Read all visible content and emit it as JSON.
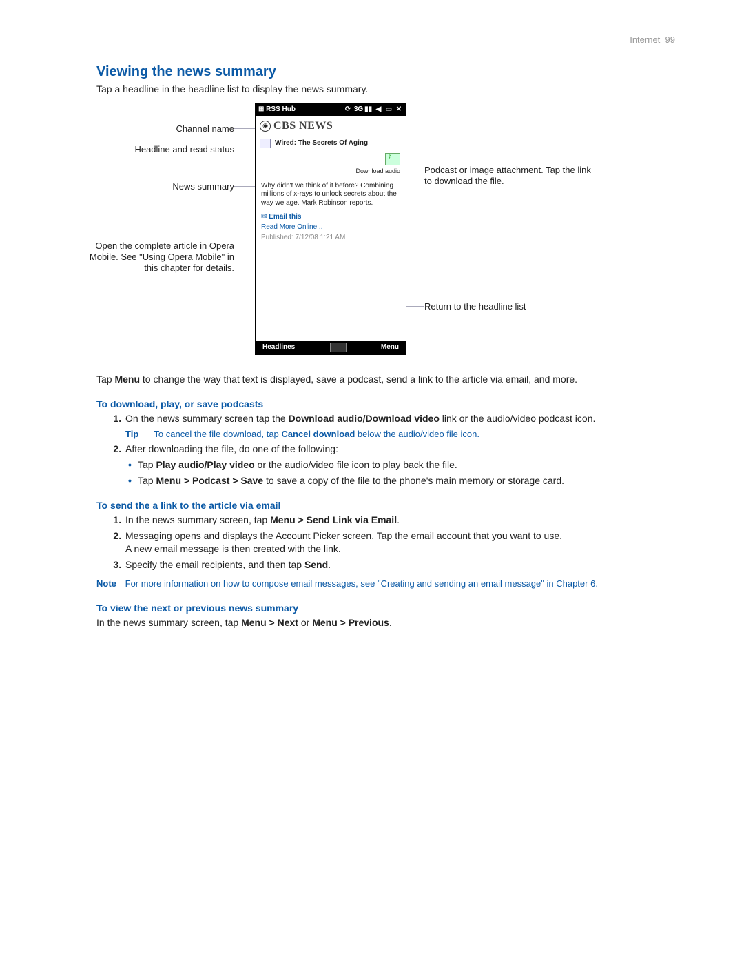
{
  "header": {
    "section": "Internet",
    "page": "99"
  },
  "h2": "Viewing the news summary",
  "intro": "Tap a headline in the headline list to display the news summary.",
  "callouts": {
    "channel": "Channel name",
    "headline": "Headline and read status",
    "summary": "News summary",
    "readmore": "Open the complete article in Opera Mobile. See \"Using Opera Mobile\" in this chapter for details.",
    "podcast": "Podcast or image attachment. Tap the link to download the file.",
    "return": "Return to the headline list"
  },
  "phone": {
    "topbar_title": "RSS Hub",
    "channel_name": "CBS NEWS",
    "headline": "Wired: The Secrets Of Aging",
    "download_link": "Download audio",
    "summary": "Why didn't we think of it before? Combining millions of x-rays to unlock secrets about the way we age. Mark Robinson reports.",
    "email_this": "Email this",
    "read_more": "Read More Online...",
    "published": "Published: 7/12/08 1:21 AM",
    "btn_left": "Headlines",
    "btn_right": "Menu"
  },
  "para_after": {
    "pre": "Tap ",
    "b1": "Menu",
    "post": " to change the way that text is displayed, save a podcast, send a link to the article via email, and more."
  },
  "sub1": "To download, play, or save podcasts",
  "s1_li1": {
    "pre": "On the news summary screen tap the ",
    "b": "Download audio/Download video",
    "post": " link or the audio/video podcast icon."
  },
  "tip": {
    "label": "Tip",
    "pre": "To cancel the file download, tap ",
    "b": "Cancel download",
    "post": " below the audio/video file icon."
  },
  "s1_li2": "After downloading the file, do one of the following:",
  "s1_b1": {
    "pre": "Tap ",
    "b": "Play audio/Play video",
    "post": " or the audio/video file icon to play back the file."
  },
  "s1_b2": {
    "pre": "Tap ",
    "b": "Menu > Podcast > Save",
    "post": " to save a copy of the file to the phone's main memory or storage card."
  },
  "sub2": "To send the a link to the article via email",
  "s2_li1": {
    "pre": "In the news summary screen, tap ",
    "b": "Menu > Send Link via Email",
    "post": "."
  },
  "s2_li2a": "Messaging opens and displays the Account Picker screen. Tap the email account that you want to use.",
  "s2_li2b": "A new email message is then created with the link.",
  "s2_li3": {
    "pre": "Specify the email recipients, and then tap ",
    "b": "Send",
    "post": "."
  },
  "note": {
    "label": "Note",
    "text": "For more information on how to compose email messages, see \"Creating and sending an email message\" in Chapter 6."
  },
  "sub3": "To view the next or previous news summary",
  "p3": {
    "pre": "In the news summary screen, tap ",
    "b1": "Menu > Next",
    "mid": " or ",
    "b2": "Menu > Previous",
    "post": "."
  }
}
